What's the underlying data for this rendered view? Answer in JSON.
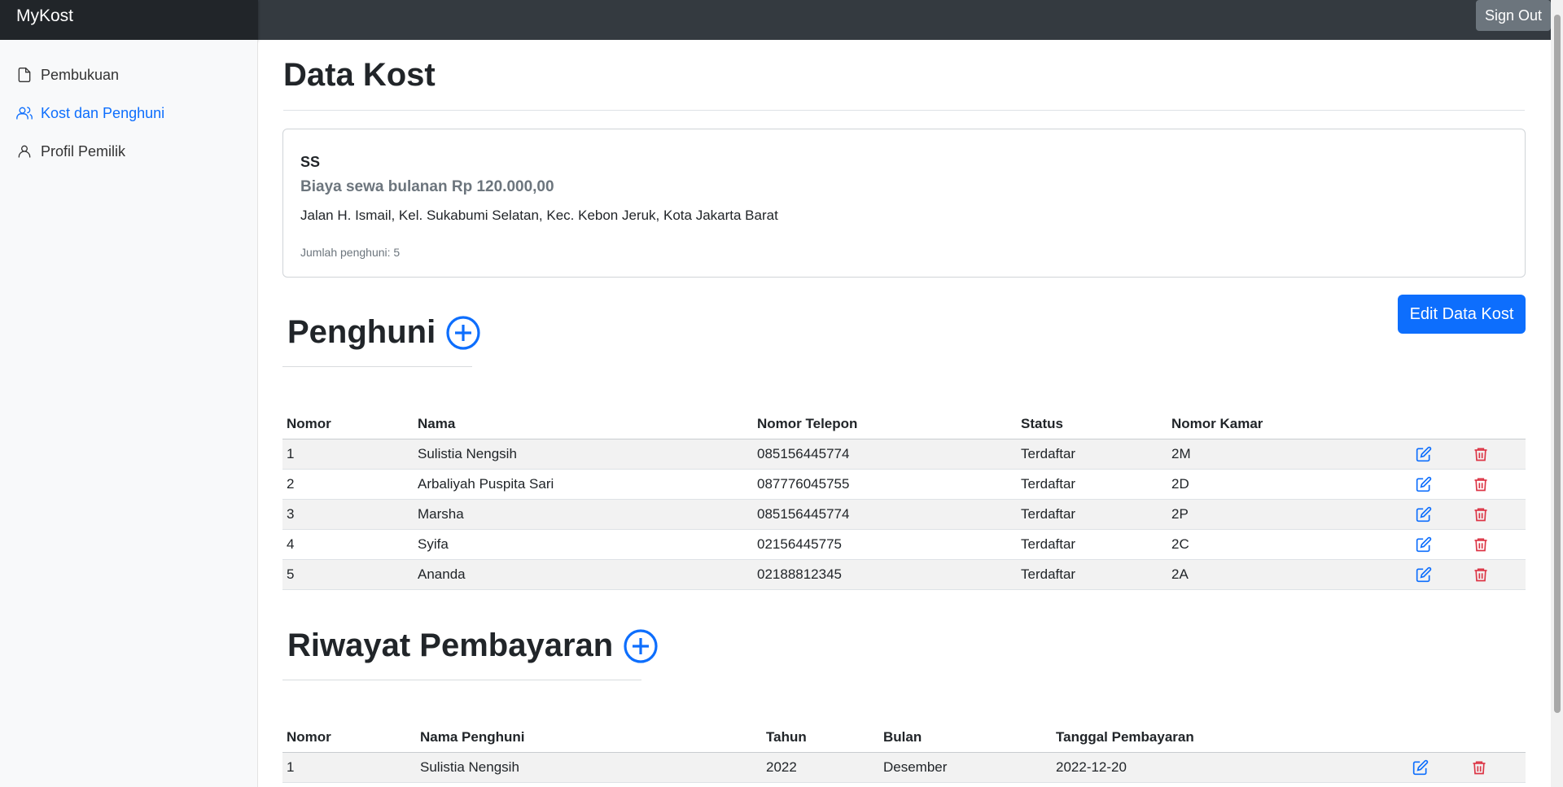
{
  "app": {
    "brand": "MyKost",
    "sign_out": "Sign Out"
  },
  "sidebar": {
    "items": [
      {
        "label": "Pembukuan",
        "icon": "file-icon",
        "active": false
      },
      {
        "label": "Kost dan Penghuni",
        "icon": "users-icon",
        "active": true
      },
      {
        "label": "Profil Pemilik",
        "icon": "user-icon",
        "active": false
      }
    ]
  },
  "main": {
    "title": "Data Kost",
    "kost": {
      "name": "SS",
      "rent": "Biaya sewa bulanan Rp 120.000,00",
      "address": "Jalan H. Ismail, Kel. Sukabumi Selatan, Kec. Kebon Jeruk, Kota Jakarta Barat",
      "tenant_count": "Jumlah penghuni: 5"
    },
    "edit_button": "Edit Data Kost",
    "penghuni": {
      "title": "Penghuni",
      "headers": [
        "Nomor",
        "Nama",
        "Nomor Telepon",
        "Status",
        "Nomor Kamar"
      ],
      "rows": [
        [
          "1",
          "Sulistia Nengsih",
          "085156445774",
          "Terdaftar",
          "2M"
        ],
        [
          "2",
          "Arbaliyah Puspita Sari",
          "087776045755",
          "Terdaftar",
          "2D"
        ],
        [
          "3",
          "Marsha",
          "085156445774",
          "Terdaftar",
          "2P"
        ],
        [
          "4",
          "Syifa",
          "02156445775",
          "Terdaftar",
          "2C"
        ],
        [
          "5",
          "Ananda",
          "02188812345",
          "Terdaftar",
          "2A"
        ]
      ]
    },
    "pembayaran": {
      "title": "Riwayat Pembayaran",
      "headers": [
        "Nomor",
        "Nama Penghuni",
        "Tahun",
        "Bulan",
        "Tanggal Pembayaran"
      ],
      "rows": [
        [
          "1",
          "Sulistia Nengsih",
          "2022",
          "Desember",
          "2022-12-20"
        ]
      ]
    }
  },
  "colors": {
    "accent": "#0d6efd",
    "danger": "#dc3545",
    "navbar": "#343a40",
    "brand_bg": "#212529"
  }
}
